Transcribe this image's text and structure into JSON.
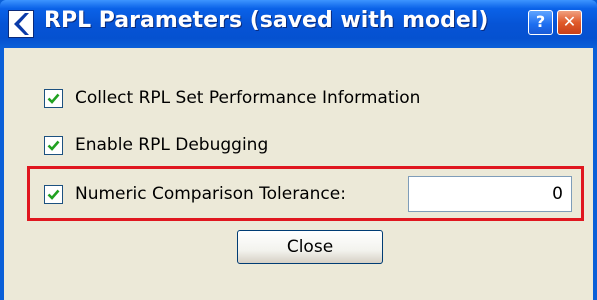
{
  "window": {
    "title": "RPL Parameters (saved with model)",
    "help_label": "?",
    "close_label": "✕",
    "app_icon": "rpl-logo-icon"
  },
  "options": [
    {
      "label": "Collect RPL Set Performance Information",
      "checked": true
    },
    {
      "label": "Enable RPL Debugging",
      "checked": true
    },
    {
      "label": "Numeric Comparison Tolerance:",
      "checked": true
    }
  ],
  "tolerance": {
    "value": "0"
  },
  "close_button": {
    "label": "Close"
  },
  "colors": {
    "titlebar": "#0654d6",
    "highlight": "#e0171f",
    "checkmark": "#21a121",
    "dialog_bg": "#ece9d8"
  }
}
